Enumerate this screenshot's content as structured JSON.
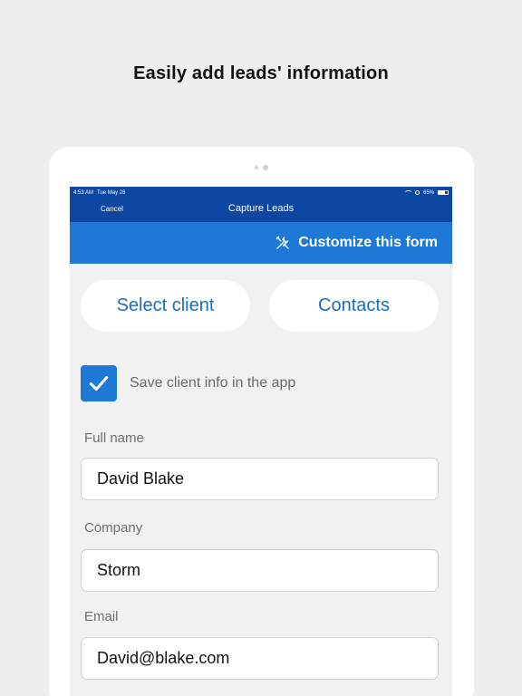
{
  "headline": "Easily add leads' information",
  "status_bar": {
    "time": "4:53 AM",
    "date": "Tue May 26",
    "battery": "65%"
  },
  "navbar": {
    "cancel_label": "Cancel",
    "title": "Capture Leads"
  },
  "customize": {
    "label": "Customize this form",
    "icon": "tools-icon"
  },
  "tabs": {
    "select_client": "Select client",
    "contacts": "Contacts"
  },
  "save_info": {
    "label": "Save client info in the app",
    "checked": true
  },
  "fields": {
    "full_name": {
      "label": "Full name",
      "value": "David Blake"
    },
    "company": {
      "label": "Company",
      "value": "Storm"
    },
    "email": {
      "label": "Email",
      "value": "David@blake.com"
    }
  },
  "colors": {
    "navbar": "#0d47a1",
    "accent": "#1e78d6",
    "pill_text": "#1a6cc4",
    "background": "#eeeeee"
  }
}
